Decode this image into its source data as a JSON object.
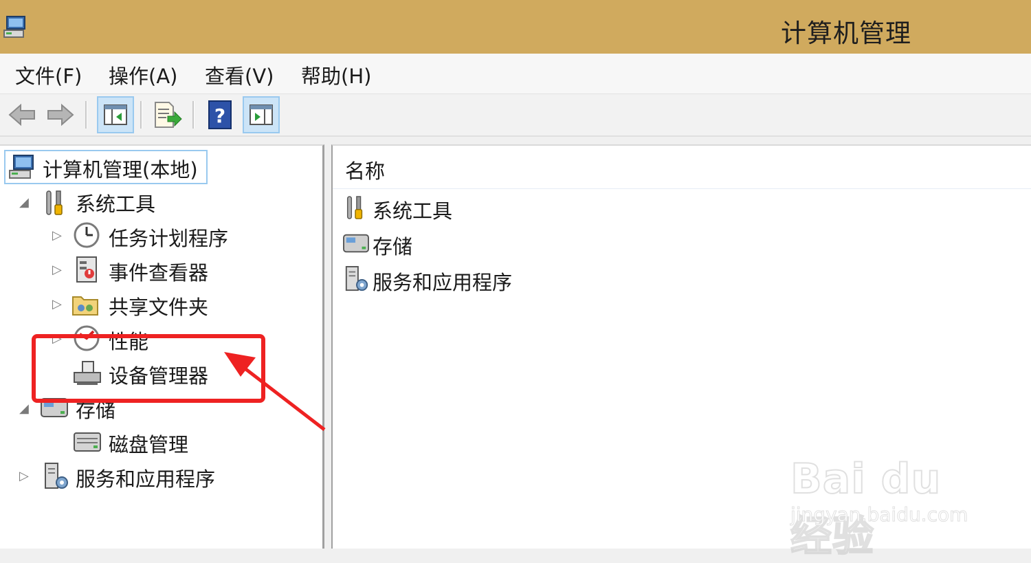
{
  "window": {
    "title": "计算机管理"
  },
  "menu": [
    {
      "label": "文件(F)"
    },
    {
      "label": "操作(A)"
    },
    {
      "label": "查看(V)"
    },
    {
      "label": "帮助(H)"
    }
  ],
  "toolbar": {
    "buttons": [
      {
        "icon": "back-arrow-icon"
      },
      {
        "icon": "forward-arrow-icon"
      },
      {
        "icon": "show-hide-console-tree-icon",
        "active": true
      },
      {
        "icon": "export-list-icon"
      },
      {
        "icon": "help-icon"
      },
      {
        "icon": "show-hide-action-pane-icon",
        "active": true
      }
    ]
  },
  "tree": {
    "root": "计算机管理(本地)",
    "system_tools": "系统工具",
    "task_scheduler": "任务计划程序",
    "event_viewer": "事件查看器",
    "shared_folders": "共享文件夹",
    "performance": "性能",
    "device_manager": "设备管理器",
    "storage": "存储",
    "disk_management": "磁盘管理",
    "services_apps": "服务和应用程序"
  },
  "details": {
    "column_name": "名称",
    "items": [
      "系统工具",
      "存储",
      "服务和应用程序"
    ]
  },
  "watermark": {
    "brand": "Bai du 经验",
    "url": "jingyan.baidu.com"
  },
  "annotation_color": "#ee2222"
}
